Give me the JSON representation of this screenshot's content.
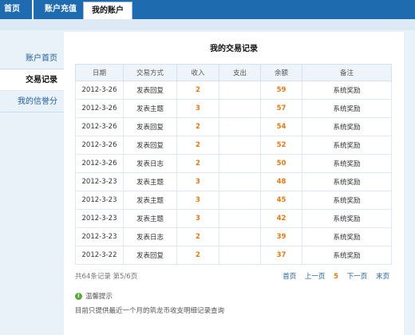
{
  "topnav": {
    "tabs": [
      {
        "label": "首页"
      },
      {
        "label": "账户充值"
      },
      {
        "label": "我的账户"
      }
    ]
  },
  "sidebar": {
    "items": [
      {
        "label": "账户首页"
      },
      {
        "label": "交易记录"
      },
      {
        "label": "我的信誉分"
      }
    ]
  },
  "main": {
    "title": "我的交易记录",
    "columns": [
      "日期",
      "交易方式",
      "收入",
      "支出",
      "余额",
      "备注"
    ],
    "rows": [
      {
        "date": "2012-3-26",
        "method": "发表回复",
        "income": "2",
        "expense": "",
        "balance": "59",
        "note": "系统奖励"
      },
      {
        "date": "2012-3-26",
        "method": "发表主题",
        "income": "3",
        "expense": "",
        "balance": "57",
        "note": "系统奖励"
      },
      {
        "date": "2012-3-26",
        "method": "发表回复",
        "income": "2",
        "expense": "",
        "balance": "54",
        "note": "系统奖励"
      },
      {
        "date": "2012-3-26",
        "method": "发表回复",
        "income": "2",
        "expense": "",
        "balance": "52",
        "note": "系统奖励"
      },
      {
        "date": "2012-3-26",
        "method": "发表日志",
        "income": "2",
        "expense": "",
        "balance": "50",
        "note": "系统奖励"
      },
      {
        "date": "2012-3-23",
        "method": "发表主题",
        "income": "3",
        "expense": "",
        "balance": "48",
        "note": "系统奖励"
      },
      {
        "date": "2012-3-23",
        "method": "发表主题",
        "income": "3",
        "expense": "",
        "balance": "45",
        "note": "系统奖励"
      },
      {
        "date": "2012-3-23",
        "method": "发表主题",
        "income": "3",
        "expense": "",
        "balance": "42",
        "note": "系统奖励"
      },
      {
        "date": "2012-3-23",
        "method": "发表日志",
        "income": "2",
        "expense": "",
        "balance": "39",
        "note": "系统奖励"
      },
      {
        "date": "2012-3-22",
        "method": "发表回复",
        "income": "2",
        "expense": "",
        "balance": "37",
        "note": "系统奖励"
      }
    ],
    "summary": "共64条记录 第5/6页",
    "pager": {
      "first": "首页",
      "prev": "上一页",
      "current": "5",
      "next": "下一页",
      "last": "末页"
    },
    "tip": {
      "icon": "info-icon",
      "title": "温馨提示",
      "text": "目前只提供最近一个月的筑龙币收支明细记录查询"
    }
  },
  "colors": {
    "nav_blue": "#1f6bb0",
    "accent_orange": "#e07a17",
    "link_blue": "#1f5f9f",
    "page_bg": "#e9f1f9"
  }
}
